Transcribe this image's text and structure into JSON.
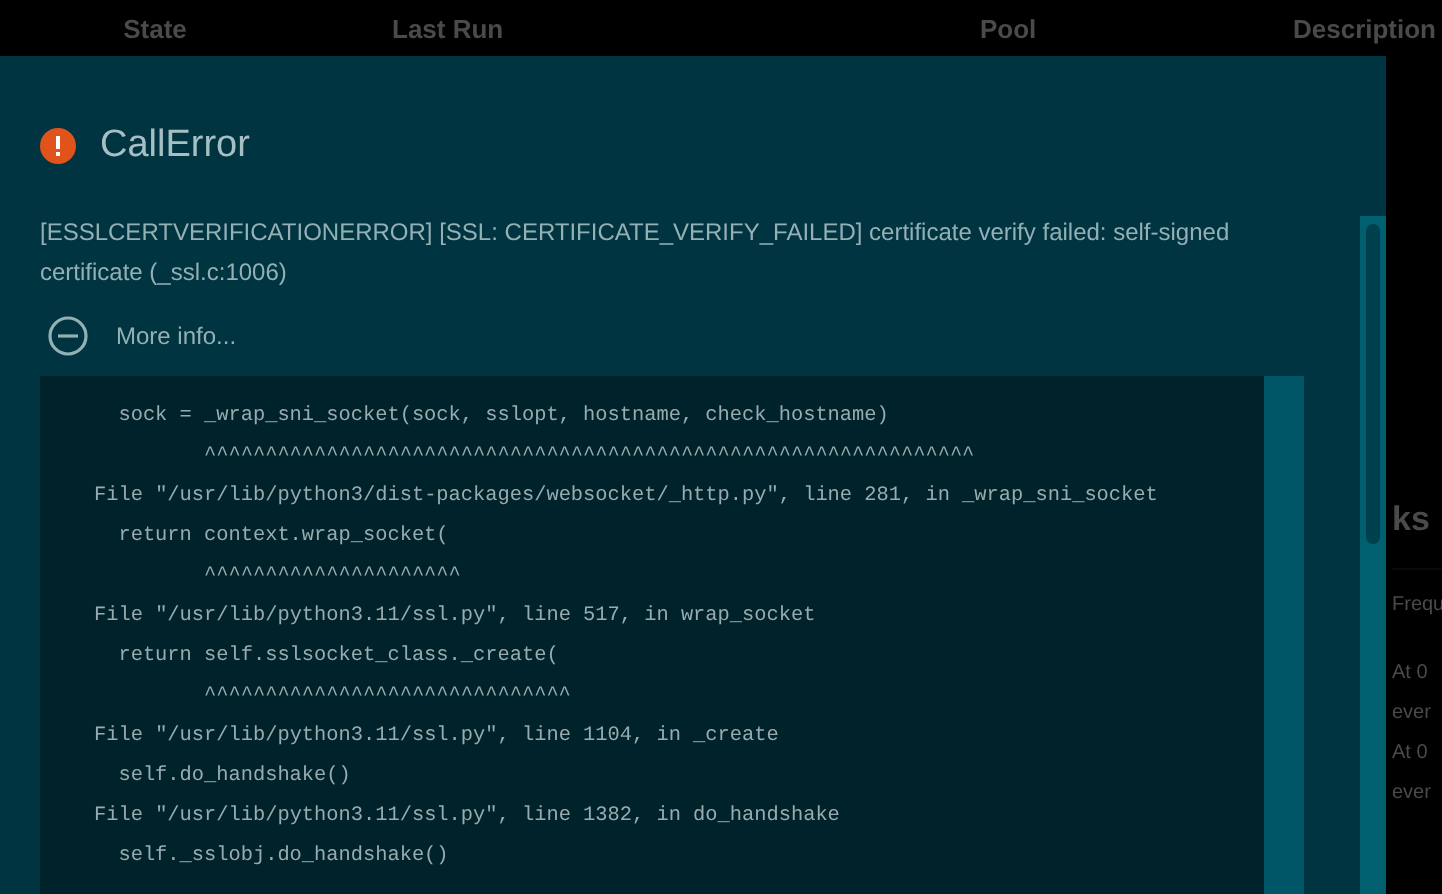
{
  "background_table": {
    "columns": [
      "State",
      "Last Run",
      "Pool",
      "Description"
    ]
  },
  "background_panel": {
    "heading": "ks",
    "lines": [
      "Frequ",
      "At 0",
      "ever",
      "At 0",
      "ever"
    ]
  },
  "dialog": {
    "title": "CallError",
    "message": "[ESSLCERTVERIFICATIONERROR] [SSL: CERTIFICATE_VERIFY_FAILED] certificate verify failed: self-signed certificate (_ssl.c:1006)",
    "more_info": {
      "label": "More info...",
      "expanded": true
    },
    "traceback": [
      {
        "kind": "code",
        "text": "sock = _wrap_sni_socket(sock, sslopt, hostname, check_hostname)"
      },
      {
        "kind": "caret",
        "text": "^^^^^^^^^^^^^^^^^^^^^^^^^^^^^^^^^^^^^^^^^^^^^^^^^^^^^^^^^^^^^^^"
      },
      {
        "kind": "file",
        "text": "File \"/usr/lib/python3/dist-packages/websocket/_http.py\", line 281, in _wrap_sni_socket"
      },
      {
        "kind": "code",
        "text": "return context.wrap_socket("
      },
      {
        "kind": "caret",
        "text": "^^^^^^^^^^^^^^^^^^^^^"
      },
      {
        "kind": "file",
        "text": "File \"/usr/lib/python3.11/ssl.py\", line 517, in wrap_socket"
      },
      {
        "kind": "code",
        "text": "return self.sslsocket_class._create("
      },
      {
        "kind": "caret",
        "text": "^^^^^^^^^^^^^^^^^^^^^^^^^^^^^^"
      },
      {
        "kind": "file",
        "text": "File \"/usr/lib/python3.11/ssl.py\", line 1104, in _create"
      },
      {
        "kind": "code",
        "text": "self.do_handshake()"
      },
      {
        "kind": "file",
        "text": "File \"/usr/lib/python3.11/ssl.py\", line 1382, in do_handshake"
      },
      {
        "kind": "code",
        "text": "self._sslobj.do_handshake()"
      }
    ]
  }
}
